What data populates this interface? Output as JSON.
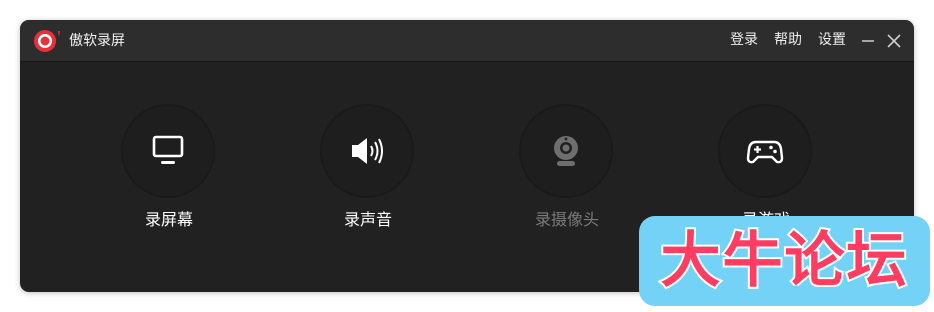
{
  "app": {
    "title": "傲软录屏",
    "logo_icon": "record-logo-icon",
    "accent_color": "#e8303b"
  },
  "menu": {
    "login": "登录",
    "help": "帮助",
    "settings": "设置"
  },
  "window_controls": {
    "minimize_icon": "minimize-icon",
    "close_icon": "close-icon"
  },
  "features": [
    {
      "label": "录屏幕",
      "icon": "monitor-icon",
      "enabled": true
    },
    {
      "label": "录声音",
      "icon": "speaker-icon",
      "enabled": true
    },
    {
      "label": "录摄像头",
      "icon": "webcam-icon",
      "enabled": false
    },
    {
      "label": "录游戏",
      "icon": "gamepad-icon",
      "enabled": true
    }
  ],
  "watermark": {
    "text": "大牛论坛",
    "background_color": "#73d2f5",
    "text_color": "#ff3d62"
  }
}
